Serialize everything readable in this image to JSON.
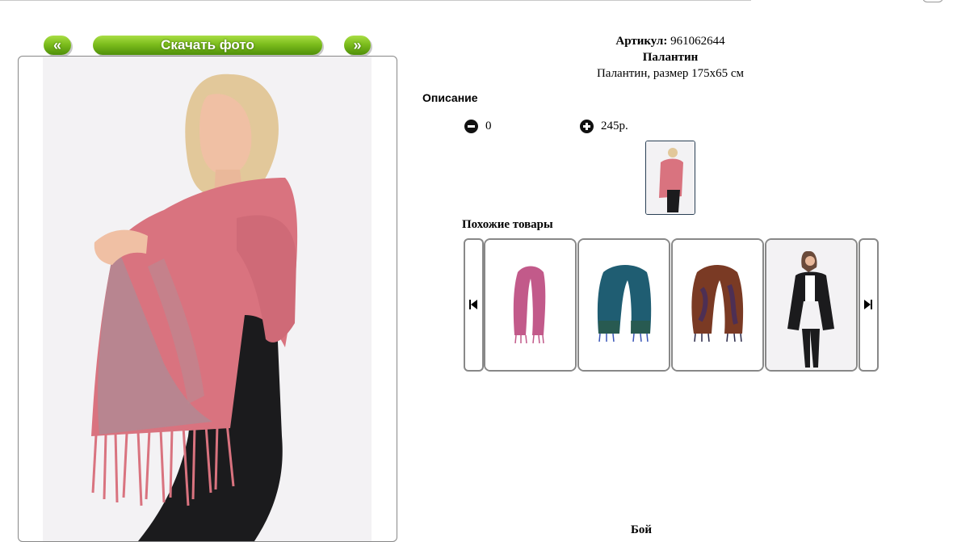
{
  "nav": {
    "prev_label": "«",
    "download_label": "Скачать фото",
    "next_label": "»"
  },
  "product": {
    "sku_label": "Артикул:",
    "sku_value": "961062644",
    "name": "Палантин",
    "subtitle": "Палантин, размер 175х65 см"
  },
  "description": {
    "title": "Описание"
  },
  "order": {
    "quantity": "0",
    "price": "245р."
  },
  "similar": {
    "title": "Похожие товары",
    "items": [
      {
        "icon": "pink-scarf-image"
      },
      {
        "icon": "teal-scarf-image"
      },
      {
        "icon": "brown-scarf-image"
      },
      {
        "icon": "black-cardigan-image"
      }
    ]
  },
  "bottom_text": "Бой",
  "colors": {
    "button_green": "#7cbd1c",
    "scarf_pink": "#d9737f",
    "frame_border": "#888888"
  }
}
